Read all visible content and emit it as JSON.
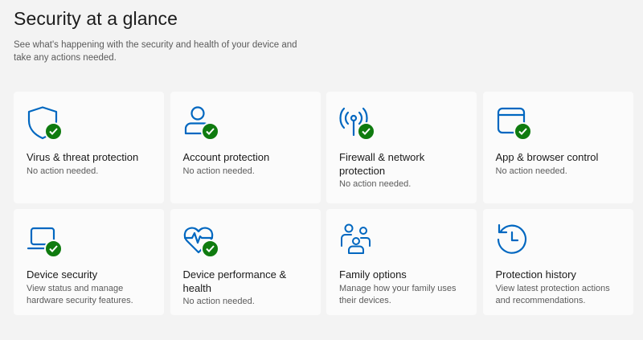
{
  "header": {
    "title": "Security at a glance",
    "subtitle": "See what's happening with the security and health of your device and take any actions needed."
  },
  "colors": {
    "accent": "#0067c0",
    "ok": "#0f7b0f"
  },
  "tiles": [
    {
      "title": "Virus & threat protection",
      "status": "No action needed.",
      "icon": "shield-icon",
      "checked": true
    },
    {
      "title": "Account protection",
      "status": "No action needed.",
      "icon": "person-icon",
      "checked": true
    },
    {
      "title": "Firewall & network protection",
      "status": "No action needed.",
      "icon": "antenna-icon",
      "checked": true
    },
    {
      "title": "App & browser control",
      "status": "No action needed.",
      "icon": "browser-window-icon",
      "checked": true
    },
    {
      "title": "Device security",
      "status": "View status and manage hardware security features.",
      "icon": "laptop-icon",
      "checked": true
    },
    {
      "title": "Device performance & health",
      "status": "No action needed.",
      "icon": "heart-pulse-icon",
      "checked": true
    },
    {
      "title": "Family options",
      "status": "Manage how your family uses their devices.",
      "icon": "family-icon",
      "checked": false
    },
    {
      "title": "Protection history",
      "status": "View latest protection actions and recommendations.",
      "icon": "history-clock-icon",
      "checked": false
    }
  ]
}
